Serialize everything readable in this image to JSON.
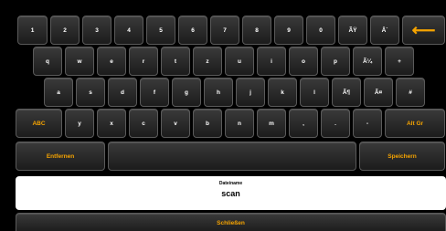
{
  "keyboard": {
    "row1": [
      "1",
      "2",
      "3",
      "4",
      "5",
      "6",
      "7",
      "8",
      "9",
      "0",
      "ÃŸ",
      "Â´"
    ],
    "row2": [
      "q",
      "w",
      "e",
      "r",
      "t",
      "z",
      "u",
      "i",
      "o",
      "p",
      "Ã¼",
      "+"
    ],
    "row3": [
      "a",
      "s",
      "d",
      "f",
      "g",
      "h",
      "j",
      "k",
      "l",
      "Ã¶",
      "Ã¤",
      "#"
    ],
    "row4": [
      "y",
      "x",
      "c",
      "v",
      "b",
      "n",
      "m",
      ",",
      ".",
      "-"
    ],
    "abc_label": "ABC",
    "altgr_label": "Alt Gr",
    "delete_label": "Entfernen",
    "save_label": "Speichern",
    "backspace_icon": "left-arrow-icon",
    "backspace_glyph": "⟵"
  },
  "filename": {
    "label": "Dateiname",
    "value": "scan"
  },
  "close_label": "Schließen",
  "colors": {
    "accent": "#f5a300",
    "key_bg": "#2b2b2b",
    "background": "#000000"
  }
}
